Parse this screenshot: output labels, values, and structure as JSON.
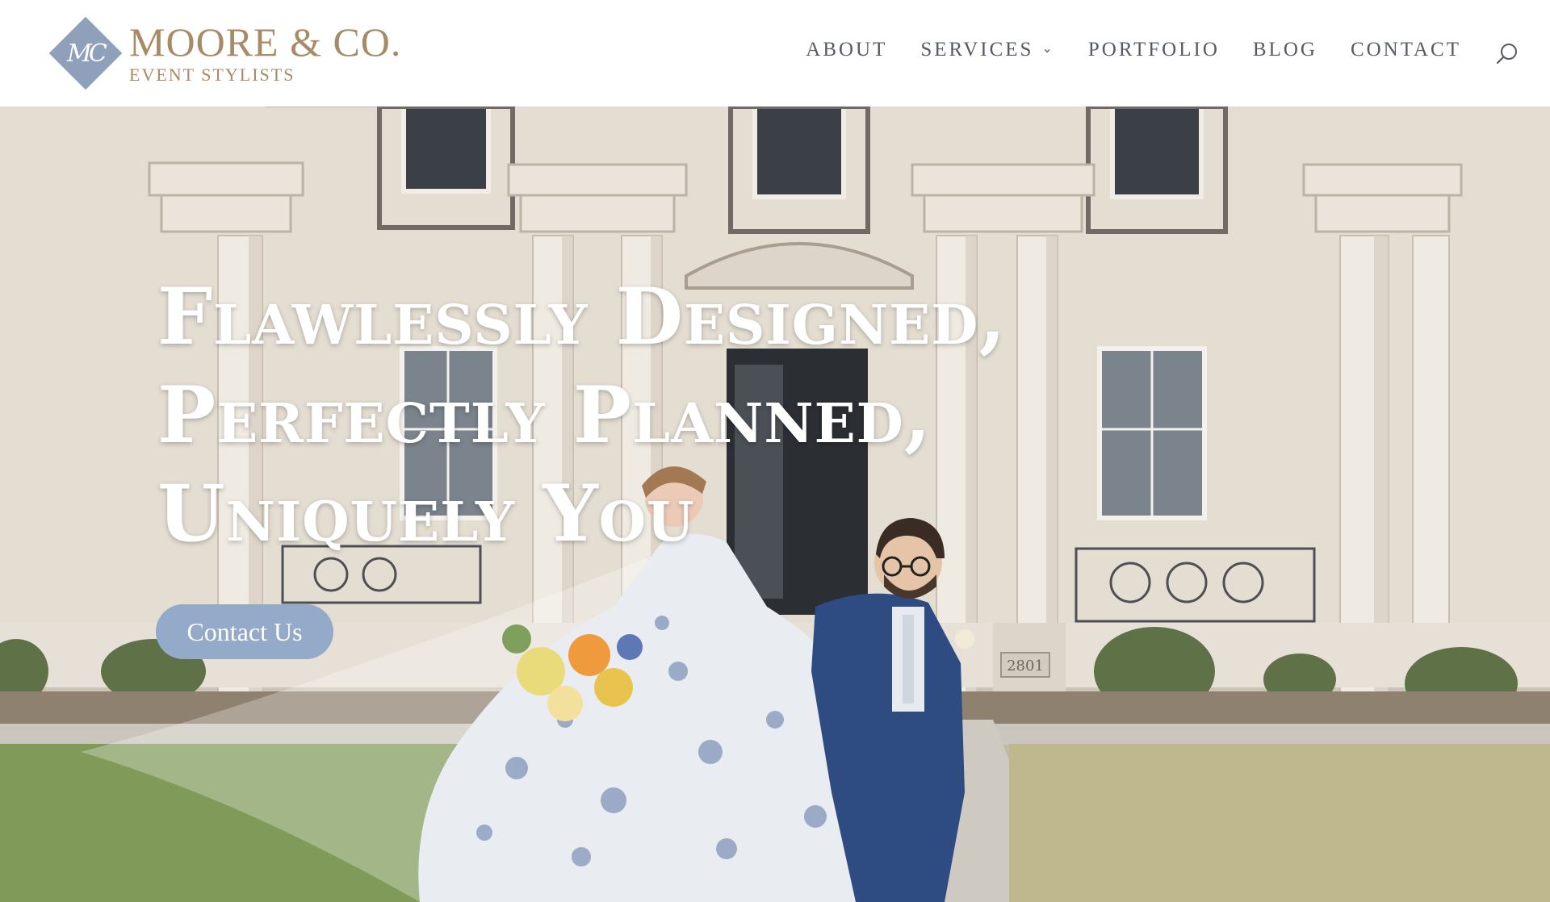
{
  "brand": {
    "monogram": "MC",
    "name": "MOORE & CO.",
    "tagline": "EVENT STYLISTS",
    "accent_color": "#a78a66",
    "mark_color": "#8fa0bb"
  },
  "nav": {
    "items": [
      {
        "label": "ABOUT"
      },
      {
        "label": "SERVICES",
        "has_dropdown": true
      },
      {
        "label": "PORTFOLIO"
      },
      {
        "label": "BLOG"
      },
      {
        "label": "CONTACT"
      }
    ],
    "search_icon": "search-icon"
  },
  "hero": {
    "headline": [
      "Flawlessly Designed,",
      "Perfectly Planned,",
      "Uniquely You"
    ],
    "cta_label": "Contact Us",
    "cta_color": "#93aac8",
    "plaque": "2801"
  }
}
